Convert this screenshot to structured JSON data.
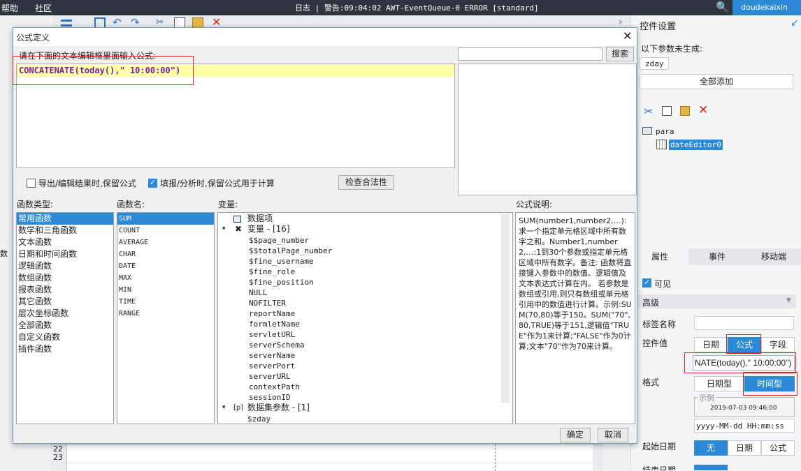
{
  "topbar": {
    "help": "帮助",
    "community": "社区",
    "log": "日志 | 警告:09:04:02 AWT-EventQueue-0 ERROR [standard]",
    "user": "doudekaixin"
  },
  "right_panel": {
    "title": "控件设置",
    "params_note": "以下参数未生成:",
    "param_tag": "zday",
    "add_all": "全部添加",
    "tree_root": "para",
    "tree_child": "dateEditor0",
    "tabs": [
      "属性",
      "事件",
      "移动端"
    ],
    "visible_label": "可见",
    "advanced": "高级",
    "tag_name_label": "标签名称",
    "widget_value_label": "控件值",
    "value_types": [
      "日期",
      "公式",
      "字段"
    ],
    "formula_value": "NATE(today(),\" 10:00:00\")",
    "format_label": "格式",
    "format_types": [
      "日期型",
      "时间型"
    ],
    "example_label": "示例",
    "example_value": "2019-07-03 09:46:00",
    "format_pattern": "yyyy-MM-dd HH:mm:ss",
    "start_date_label": "起始日期",
    "start_opts": [
      "无",
      "日期",
      "公式"
    ],
    "end_date_label": "结束日期",
    "left_side_label": "数据集"
  },
  "dialog": {
    "title": "公式定义",
    "prompt": "请在下面的文本编辑框里面输入公式:",
    "formula": "CONCATENATE(today(),\" 10:00:00\")",
    "search_button": "搜索",
    "check1_label": "导出/编辑结果时,保留公式",
    "check2_label": "填报/分析时,保留公式用于计算",
    "check_button": "检查合法性",
    "func_types_label": "函数类型:",
    "func_types": [
      "常用函数",
      "数学和三角函数",
      "文本函数",
      "日期和时间函数",
      "逻辑函数",
      "数组函数",
      "报表函数",
      "其它函数",
      "层次坐标函数",
      "全部函数",
      "自定义函数",
      "插件函数"
    ],
    "func_names_label": "函数名:",
    "func_names": [
      "SUM",
      "COUNT",
      "AVERAGE",
      "CHAR",
      "DATE",
      "MAX",
      "MIN",
      "TIME",
      "RANGE"
    ],
    "vars_label": "变量:",
    "var_root1": "数据项",
    "var_root2": "变量 - [16]",
    "var_items": [
      "$$page_number",
      "$$totalPage_number",
      "$fine_username",
      "$fine_role",
      "$fine_position",
      "NULL",
      "NOFILTER",
      "reportName",
      "formletName",
      "servletURL",
      "serverSchema",
      "serverName",
      "serverPort",
      "serverURL",
      "contextPath",
      "sessionID"
    ],
    "var_root3": "数据集参数 - [1]",
    "var_item_last": "$zday",
    "desc_label": "公式说明:",
    "description": "SUM(number1,number2,…): 求一个指定单元格区域中所有数字之和。Number1,number2,…:1到30个参数或指定单元格区域中所有数字。备注:    函数将直接键入参数中的数值、逻辑值及文本表达式计算在内。    若参数是数组或引用,则只有数组或单元格引用中的数值进行计算。示例:SUM(70,80)等于150。SUM(\"70\",80,TRUE)等于151,逻辑值\"TRUE\"作为1来计算;\"FALSE\"作为0计算;文本\"70\"作为70来计算。",
    "ok": "确定",
    "cancel": "取消"
  },
  "bg": {
    "row22": "22",
    "row23": "23"
  }
}
